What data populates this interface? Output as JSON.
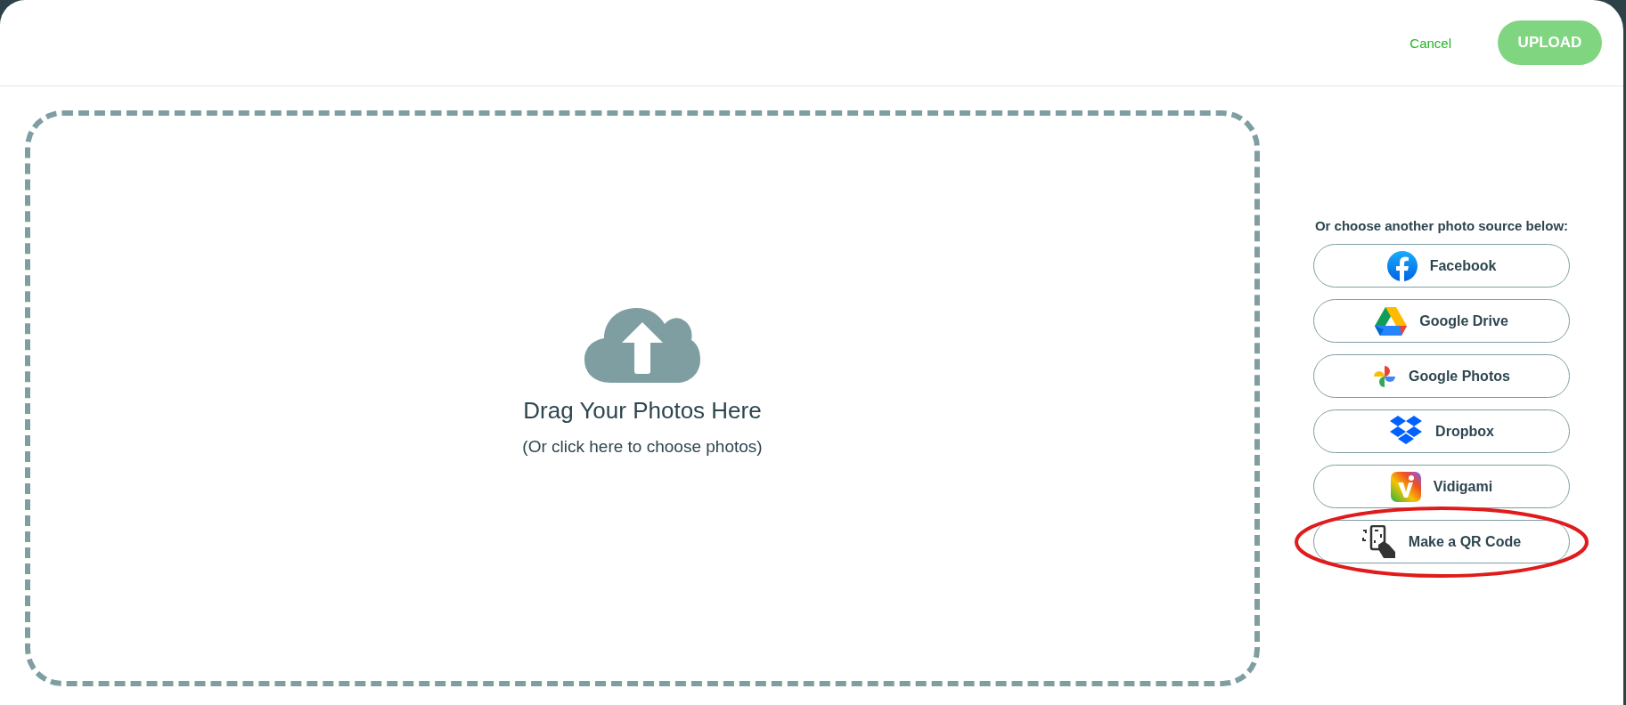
{
  "header": {
    "cancel": "Cancel",
    "upload": {
      "label": "UPLOAD",
      "disabled": true
    }
  },
  "dropzone": {
    "title": "Drag Your Photos Here",
    "subtitle": "(Or click here to choose photos)"
  },
  "sources": {
    "heading": "Or choose another photo source below:",
    "items": [
      {
        "kind": "facebook",
        "label": "Facebook",
        "highlighted": false
      },
      {
        "kind": "drive",
        "label": "Google Drive",
        "highlighted": false
      },
      {
        "kind": "photos",
        "label": "Google Photos",
        "highlighted": false
      },
      {
        "kind": "dropbox",
        "label": "Dropbox",
        "highlighted": false
      },
      {
        "kind": "vidigami",
        "label": "Vidigami",
        "highlighted": false
      },
      {
        "kind": "qr",
        "label": "Make a QR Code",
        "highlighted": true
      }
    ]
  }
}
